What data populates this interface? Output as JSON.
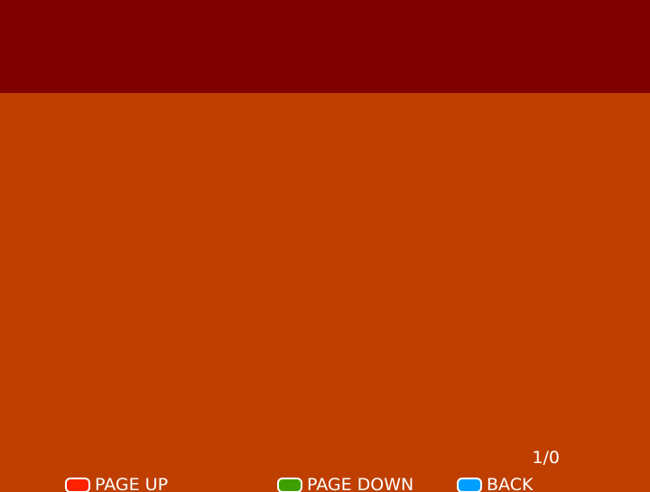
{
  "colors": {
    "header_band": "#7F0000",
    "background": "#BF3F00",
    "text": "#FFFFFF",
    "red_key": "#FF2200",
    "green_key": "#3F9F00",
    "blue_key": "#009FFF"
  },
  "content": {
    "page_indicator": "1/0"
  },
  "footer": {
    "page_up": {
      "label": "PAGE UP",
      "key_icon": "red-key-icon"
    },
    "page_down": {
      "label": "PAGE DOWN",
      "key_icon": "green-key-icon"
    },
    "back": {
      "label": "BACK",
      "key_icon": "blue-key-icon"
    }
  }
}
